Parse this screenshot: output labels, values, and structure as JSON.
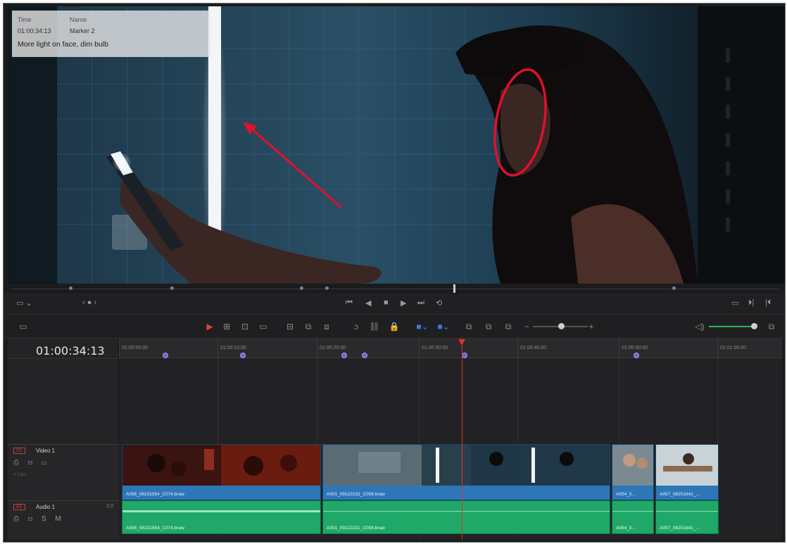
{
  "viewer": {
    "marker_note": {
      "time_header": "Time",
      "name_header": "Name",
      "time_value": "01:00:34:13",
      "name_value": "Marker 2",
      "note": "More light on face, dim bulb"
    },
    "annotation_color": "#e0102e"
  },
  "transport": {
    "left_controls": [
      "▭ ⌄",
      "‹ ● ›"
    ],
    "buttons": [
      "⏮",
      "◀",
      "■",
      "▶",
      "⏭",
      "⟲"
    ],
    "right_controls": [
      "▭",
      "⏵|",
      "|⏴"
    ]
  },
  "toolbar": {
    "tools": [
      "▶",
      "⊞",
      "⊡",
      "▭",
      "⊟",
      "⧉",
      "⧈",
      "ↄ",
      "⛓",
      "🔒",
      "■⌄",
      "■⌄",
      "⧉",
      "⧉",
      "⧉",
      "−",
      "+"
    ],
    "volume_icon": "◁)",
    "zoom_label": "⧉"
  },
  "timeline": {
    "timecode": "01:00:34:13",
    "ruler_labels": [
      "01:00:00:00",
      "01:00:10:00",
      "01:00:20:00",
      "01:00:30:00",
      "01:00:40:00",
      "01:00:50:00",
      "01:01:00:00"
    ],
    "tracks": {
      "video": {
        "id": "V1",
        "name": "Video 1",
        "icons": "⎙ ⊡ ▭",
        "sub": "4 Clips"
      },
      "audio": {
        "id": "A1",
        "name": "Audio 1",
        "level": "2.0",
        "icons": "⎙ ⊡ S M"
      }
    },
    "video_clips": [
      {
        "name": "A056_08231954_C074.braw"
      },
      {
        "name": "A001_09122231_C008.braw"
      },
      {
        "name": "A054_0..."
      },
      {
        "name": "A057_08251641_..."
      }
    ],
    "audio_clips": [
      {
        "name": "A056_08231954_C074.braw"
      },
      {
        "name": "A001_09122231_C008.braw"
      },
      {
        "name": "A054_0..."
      },
      {
        "name": "A057_08251641_..."
      }
    ],
    "colors": {
      "video_clip": "#2d77b8",
      "audio_clip": "#1fa868",
      "playhead": "#e0302a",
      "marker": "#6f63d8"
    }
  }
}
